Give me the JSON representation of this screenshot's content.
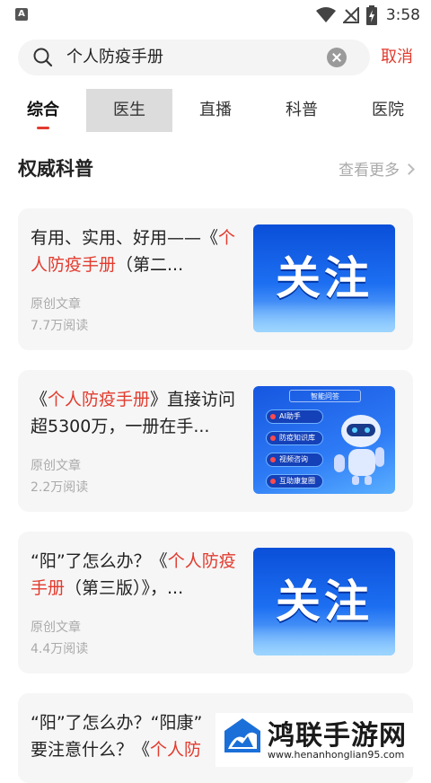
{
  "status_bar": {
    "time": "3:58",
    "app_indicator": "A",
    "icons": [
      "wifi-icon",
      "no-signal-icon",
      "battery-charging-icon"
    ]
  },
  "search": {
    "query": "个人防疫手册",
    "cancel_label": "取消"
  },
  "tabs": [
    {
      "label": "综合",
      "active": true
    },
    {
      "label": "医生",
      "pressed": true
    },
    {
      "label": "直播"
    },
    {
      "label": "科普"
    },
    {
      "label": "医院"
    }
  ],
  "section": {
    "title": "权威科普",
    "see_more": "查看更多"
  },
  "articles": [
    {
      "title_pre": "有用、实用、好用——《",
      "title_hl": "个人防疫手册",
      "title_post": "（第二...",
      "source": "原创文章",
      "reads": "7.7万阅读",
      "thumb_text": "关注"
    },
    {
      "title_pre": "《",
      "title_hl": "个人防疫手册",
      "title_post": "》直接访问超5300万，一册在手...",
      "source": "原创文章",
      "reads": "2.2万阅读",
      "thumb_header": "智能问答",
      "thumb_items": [
        "AI助手",
        "防疫知识库",
        "视频咨询",
        "互助康复圈"
      ]
    },
    {
      "title_pre": "“阳”了怎么办？《",
      "title_hl": "个人防疫手册",
      "title_post": "（第三版）》，...",
      "source": "原创文章",
      "reads": "4.4万阅读",
      "thumb_text": "关注"
    },
    {
      "title_pre": "“阳”了怎么办？“阳康”",
      "title_line2_pre": "要注意什么？《",
      "title_hl": "个人防",
      "title_post": ""
    }
  ],
  "watermark": {
    "name": "鸿联手游网",
    "url": "www.henanhonglian95.com"
  },
  "colors": {
    "accent": "#e23b2e",
    "card_bg": "#f6f6f6",
    "muted": "#aaaaaa"
  }
}
